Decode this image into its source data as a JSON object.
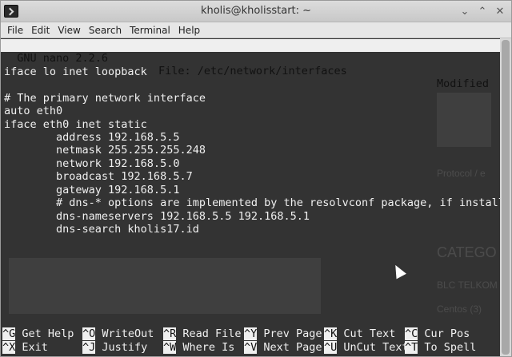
{
  "window": {
    "title": "kholis@kholisstart: ~",
    "minimize_glyph": "⌄",
    "maximize_glyph": "⌃",
    "close_glyph": "✕"
  },
  "menu": [
    "File",
    "Edit",
    "View",
    "Search",
    "Terminal",
    "Help"
  ],
  "nano": {
    "version": "  GNU nano 2.2.6",
    "file": "File: /etc/network/interfaces",
    "status": "Modified"
  },
  "lines": [
    "",
    "iface lo inet loopback",
    "",
    "# The primary network interface",
    "auto eth0",
    "iface eth0 inet static",
    "        address 192.168.5.5",
    "        netmask 255.255.255.248",
    "        network 192.168.5.0",
    "        broadcast 192.168.5.7",
    "        gateway 192.168.5.1",
    "        # dns-* options are implemented by the resolvconf package, if installed",
    "        dns-nameservers 192.168.5.5 192.168.5.1",
    "        dns-search kholis17.id"
  ],
  "shortcuts_row1": [
    {
      "key": "^G",
      "label": "Get Help"
    },
    {
      "key": "^O",
      "label": "WriteOut"
    },
    {
      "key": "^R",
      "label": "Read File"
    },
    {
      "key": "^Y",
      "label": "Prev Page"
    },
    {
      "key": "^K",
      "label": "Cut Text"
    },
    {
      "key": "^C",
      "label": "Cur Pos"
    }
  ],
  "shortcuts_row2": [
    {
      "key": "^X",
      "label": "Exit"
    },
    {
      "key": "^J",
      "label": "Justify"
    },
    {
      "key": "^W",
      "label": "Where Is"
    },
    {
      "key": "^V",
      "label": "Next Page"
    },
    {
      "key": "^U",
      "label": "UnCut Text"
    },
    {
      "key": "^T",
      "label": "To Spell"
    }
  ],
  "background_ghost_text": [
    "CATEGO",
    "BLC TELKOM",
    "Centos (3)",
    "Protocol / e"
  ]
}
